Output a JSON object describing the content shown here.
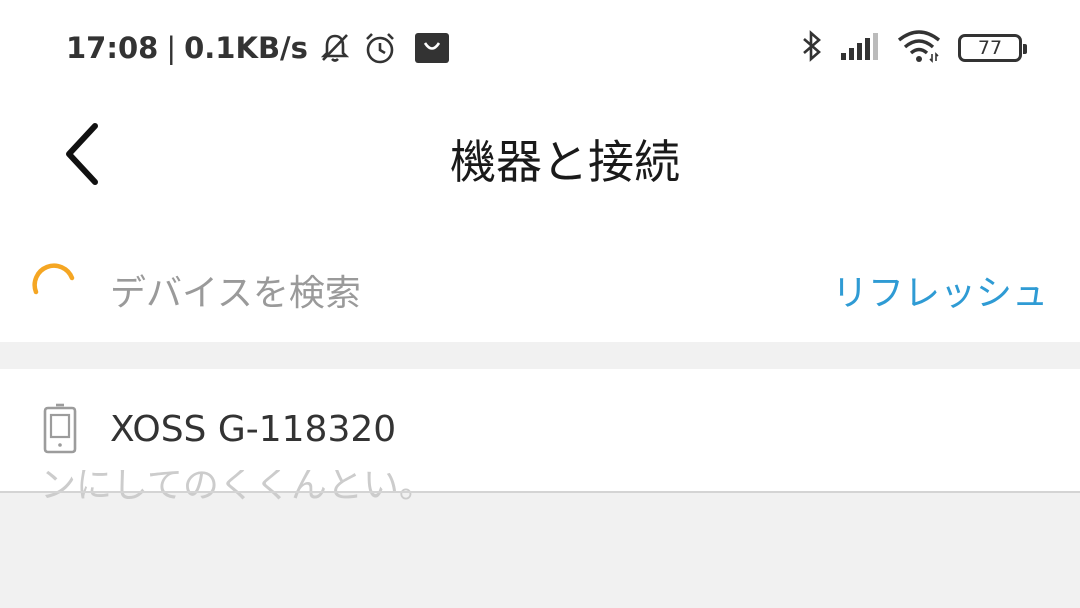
{
  "status_bar": {
    "time": "17:08",
    "separator": "|",
    "network_speed": "0.1KB/s",
    "icons": [
      "bell-muted-icon",
      "alarm-icon",
      "store-bag-icon",
      "bluetooth-icon",
      "signal-icon",
      "wifi-icon"
    ],
    "battery_level": "77"
  },
  "header": {
    "title": "機器と接続",
    "back_icon": "chevron-left-icon"
  },
  "search": {
    "label": "デバイスを検索",
    "refresh_label": "リフレッシュ",
    "spinner_color": "#f5a623"
  },
  "devices": [
    {
      "name": "XOSS G-118320",
      "icon": "device-icon"
    }
  ],
  "overlay_text": "ンにしてのくくんとい。",
  "colors": {
    "accent": "#2f9bd4",
    "spinner": "#f5a623",
    "background": "#f1f1f1"
  }
}
